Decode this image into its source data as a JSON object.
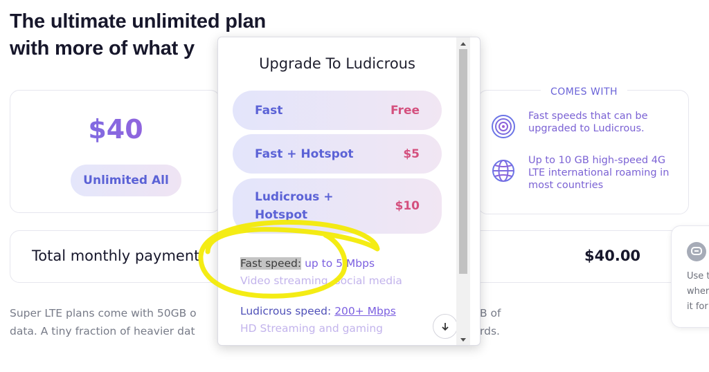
{
  "headline": {
    "line1": "The ultimate unlimited plan",
    "line2": "with more of what y"
  },
  "price_card": {
    "price": "$40",
    "plan": "Unlimited All"
  },
  "comes_with": {
    "title": "COMES WITH",
    "features": [
      {
        "icon": "broadcast-icon",
        "text": "Fast speeds that can be upgraded to Ludicrous."
      },
      {
        "icon": "globe-icon",
        "text": "Up to 10 GB high-speed 4G LTE international roaming in most countries"
      }
    ]
  },
  "total": {
    "label": "Total monthly payment",
    "value": "$40.00"
  },
  "footnote": {
    "line1": "Super LTE plans come with 50GB o",
    "line2": "data. A tiny fraction of heavier dat",
    "right1": "B of",
    "right2": "rds."
  },
  "chat": {
    "icon": "chat-icon",
    "lines": [
      "Use t",
      "wher",
      "it for"
    ]
  },
  "popup": {
    "title": "Upgrade To Ludicrous",
    "options": [
      {
        "name": "Fast",
        "price": "Free"
      },
      {
        "name": "Fast + Hotspot",
        "price": "$5"
      },
      {
        "name_line1": "Ludicrous +",
        "name_line2": "Hotspot",
        "price": "$10"
      }
    ],
    "speeds": [
      {
        "label": "Fast speed:",
        "value": "up to 5 Mbps",
        "sub": "Video streaming, social media"
      },
      {
        "label": "Ludicrous speed:",
        "value": "200+ Mbps",
        "sub": "HD Streaming and gaming"
      }
    ],
    "scroll_down_icon": "arrow-down-icon"
  },
  "colors": {
    "accent_blue": "#5b62d6",
    "accent_pink": "#d4507e",
    "accent_purple": "#7b62d4",
    "annotation_yellow": "#f3ea00"
  }
}
